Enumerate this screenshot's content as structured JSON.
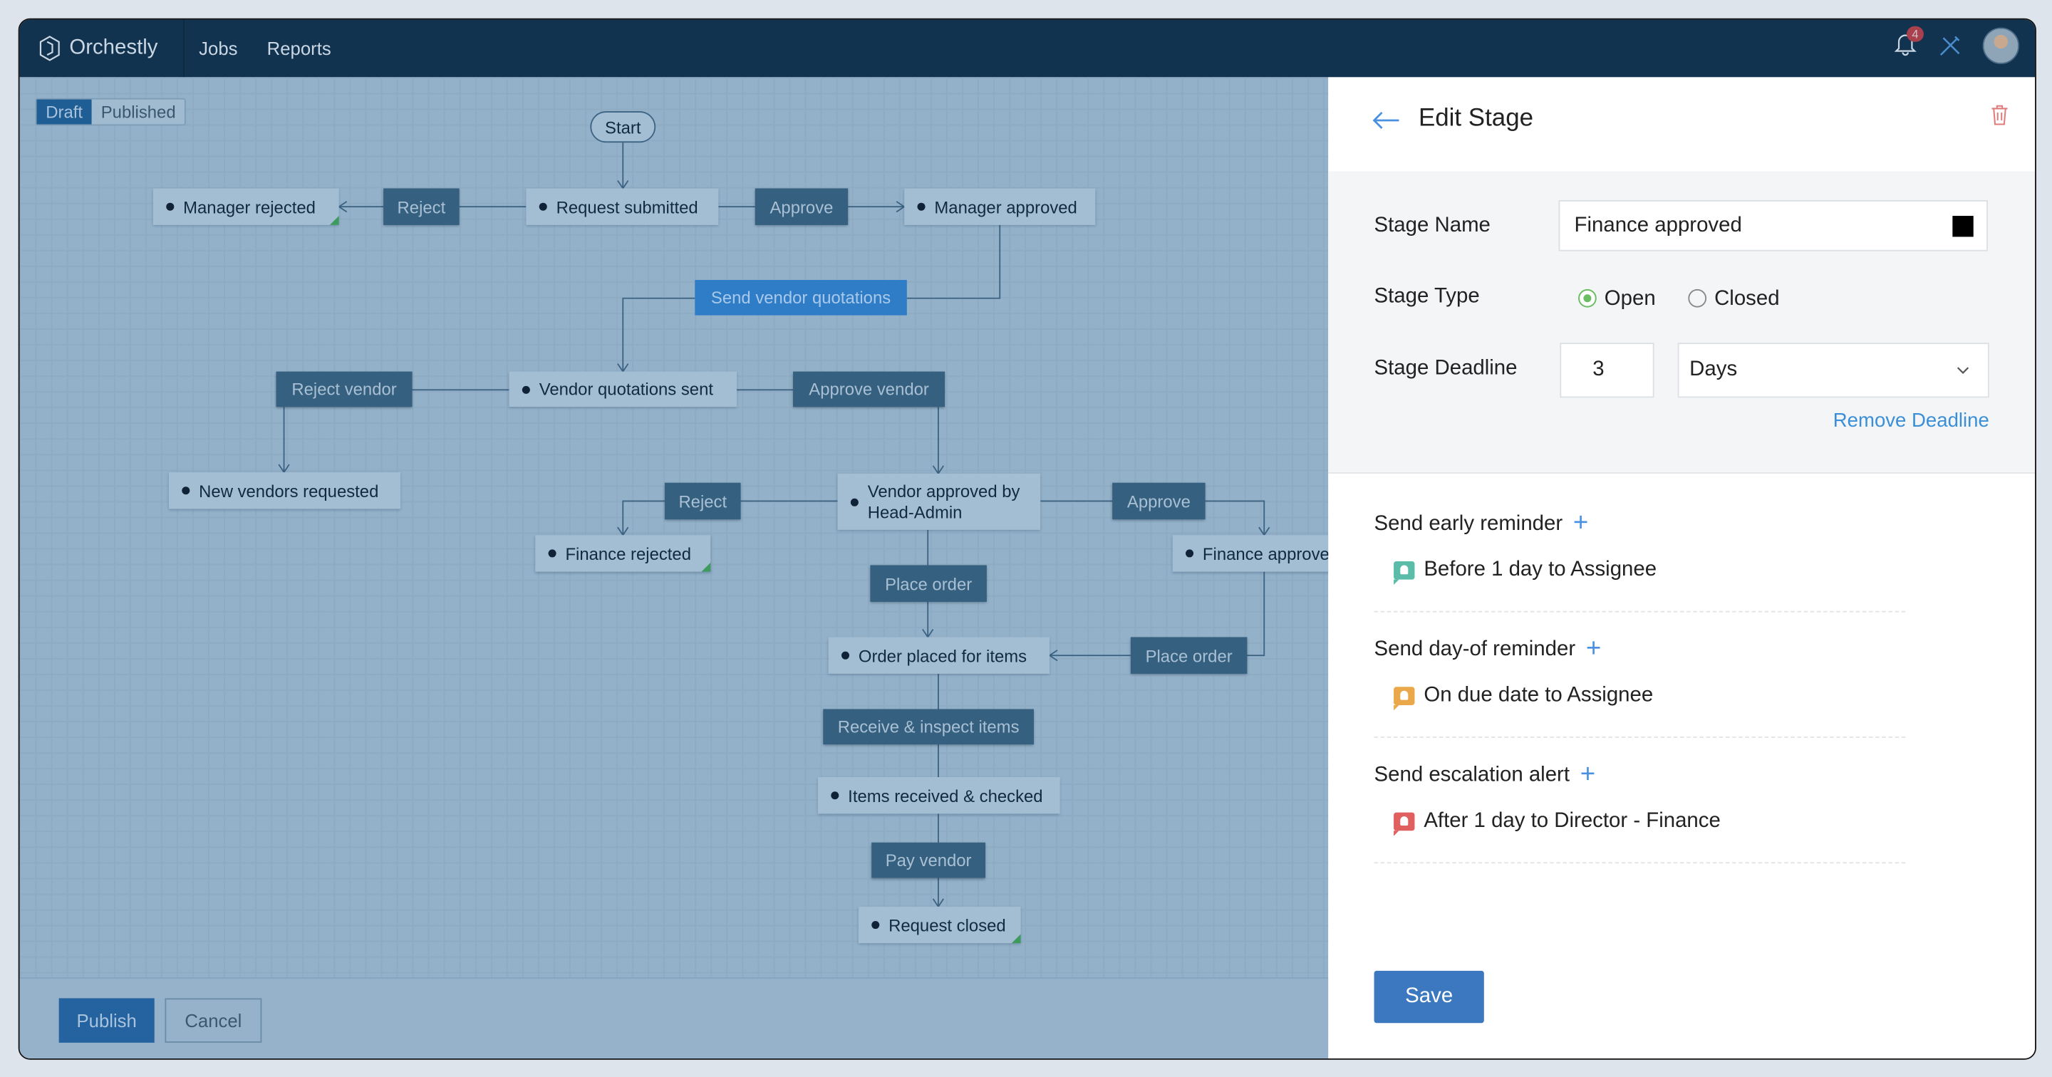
{
  "topbar": {
    "brand": "Orchestly",
    "nav": [
      "Jobs",
      "Reports"
    ],
    "notification_count": "4",
    "icons": [
      "bell-icon",
      "tools-icon",
      "avatar"
    ]
  },
  "canvas": {
    "toggle": {
      "draft": "Draft",
      "published": "Published",
      "selected": "Draft"
    },
    "nodes": [
      {
        "label": "Start",
        "kind": "pill"
      },
      {
        "label": "Manager rejected",
        "kind": "state",
        "end": true
      },
      {
        "label": "Reject",
        "kind": "action"
      },
      {
        "label": "Request submitted",
        "kind": "state"
      },
      {
        "label": "Approve",
        "kind": "action"
      },
      {
        "label": "Manager approved",
        "kind": "state"
      },
      {
        "label": "Send vendor quotations",
        "kind": "highlight"
      },
      {
        "label": "Reject vendor",
        "kind": "action"
      },
      {
        "label": "Vendor quotations sent",
        "kind": "state"
      },
      {
        "label": "Approve vendor",
        "kind": "action"
      },
      {
        "label": "New vendors requested",
        "kind": "state"
      },
      {
        "label": "Reject",
        "kind": "action"
      },
      {
        "label": "Vendor approved by Head-Admin",
        "kind": "state"
      },
      {
        "label": "Approve",
        "kind": "action"
      },
      {
        "label": "Finance rejected",
        "kind": "state",
        "end": true
      },
      {
        "label": "Finance approved",
        "kind": "state"
      },
      {
        "label": "Place order",
        "kind": "action"
      },
      {
        "label": "Order placed for items",
        "kind": "state"
      },
      {
        "label": "Place order",
        "kind": "action"
      },
      {
        "label": "Receive & inspect items",
        "kind": "action"
      },
      {
        "label": "Items received & checked",
        "kind": "state"
      },
      {
        "label": "Pay vendor",
        "kind": "action"
      },
      {
        "label": "Request closed",
        "kind": "state",
        "end": true
      }
    ],
    "publish": "Publish",
    "cancel": "Cancel"
  },
  "panel": {
    "title": "Edit Stage",
    "stage_name_label": "Stage Name",
    "stage_name": "Finance approved",
    "stage_color": "#000000",
    "stage_type_label": "Stage Type",
    "type_open": "Open",
    "type_closed": "Closed",
    "type_selected": "Open",
    "deadline_label": "Stage Deadline",
    "deadline_value": "3",
    "deadline_unit": "Days",
    "remove_deadline": "Remove Deadline",
    "reminders": [
      {
        "title": "Send early reminder",
        "item": "Before 1 day to Assignee",
        "color": "#5bbcaa"
      },
      {
        "title": "Send day-of reminder",
        "item": "On due date to Assignee",
        "color": "#eaa84a"
      },
      {
        "title": "Send escalation alert",
        "item": "After 1 day to Director - Finance",
        "color": "#e06060"
      }
    ],
    "save": "Save"
  }
}
